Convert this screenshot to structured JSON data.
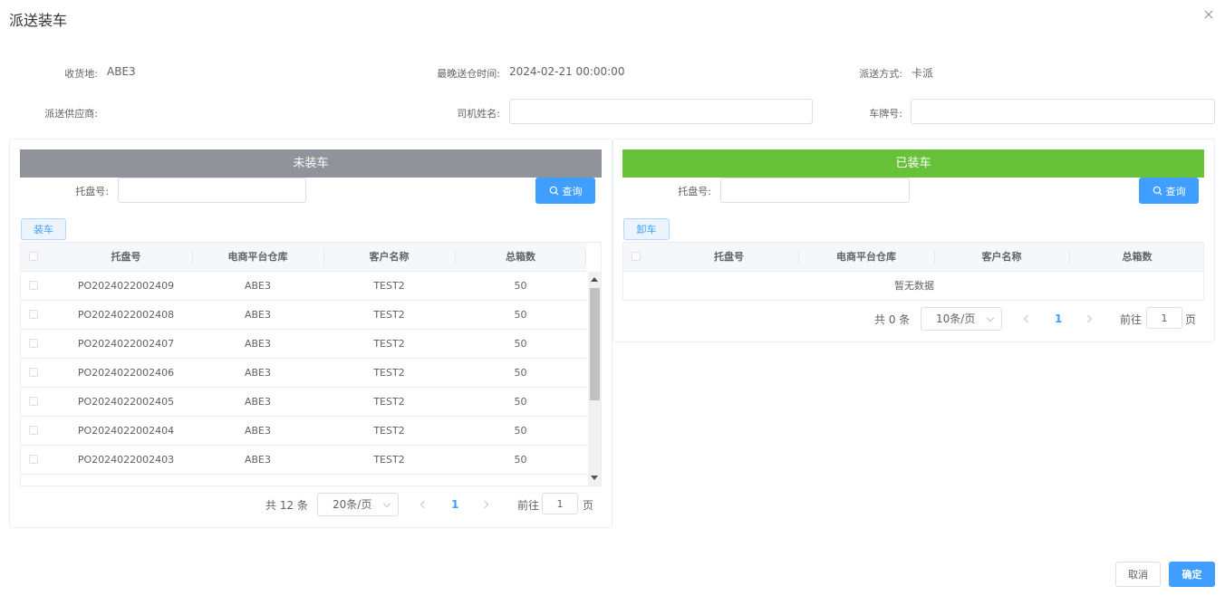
{
  "dialog": {
    "title": "派送装车"
  },
  "info": {
    "consignee_label": "收货地:",
    "consignee_value": "ABE3",
    "latest_time_label": "最晚送仓时间:",
    "latest_time_value": "2024-02-21 00:00:00",
    "delivery_method_label": "派送方式:",
    "delivery_method_value": "卡派",
    "supplier_label": "派送供应商:",
    "driver_label": "司机姓名:",
    "driver_value": "",
    "plate_label": "车牌号:",
    "plate_value": ""
  },
  "unloaded": {
    "header": "未装车",
    "header_color": "#909399",
    "pallet_label": "托盘号:",
    "pallet_value": "",
    "query_label": "查询",
    "action_label": "装车",
    "columns": [
      "托盘号",
      "电商平台仓库",
      "客户名称",
      "总箱数"
    ],
    "rows": [
      [
        "PO2024022002409",
        "ABE3",
        "TEST2",
        "50"
      ],
      [
        "PO2024022002408",
        "ABE3",
        "TEST2",
        "50"
      ],
      [
        "PO2024022002407",
        "ABE3",
        "TEST2",
        "50"
      ],
      [
        "PO2024022002406",
        "ABE3",
        "TEST2",
        "50"
      ],
      [
        "PO2024022002405",
        "ABE3",
        "TEST2",
        "50"
      ],
      [
        "PO2024022002404",
        "ABE3",
        "TEST2",
        "50"
      ],
      [
        "PO2024022002403",
        "ABE3",
        "TEST2",
        "50"
      ]
    ],
    "pagination": {
      "total": "共 12 条",
      "page_size": "20条/页",
      "current_page": "1",
      "goto_label": "前往",
      "goto_value": "1",
      "page_unit": "页"
    }
  },
  "loaded": {
    "header": "已装车",
    "header_color": "#67c23a",
    "pallet_label": "托盘号:",
    "pallet_value": "",
    "query_label": "查询",
    "action_label": "卸车",
    "columns": [
      "托盘号",
      "电商平台仓库",
      "客户名称",
      "总箱数"
    ],
    "empty_text": "暂无数据",
    "pagination": {
      "total": "共 0 条",
      "page_size": "10条/页",
      "current_page": "1",
      "goto_label": "前往",
      "goto_value": "1",
      "page_unit": "页"
    }
  },
  "footer": {
    "cancel_label": "取消",
    "confirm_label": "确定"
  },
  "colors": {
    "primary": "#409eff"
  }
}
